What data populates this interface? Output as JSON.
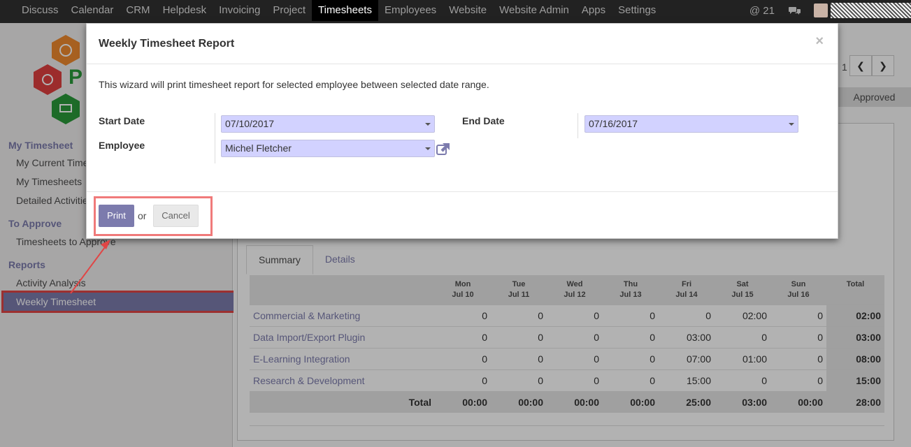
{
  "topbar": {
    "menu": [
      "Discuss",
      "Calendar",
      "CRM",
      "Helpdesk",
      "Invoicing",
      "Project",
      "Timesheets",
      "Employees",
      "Website",
      "Website Admin",
      "Apps",
      "Settings"
    ],
    "active_index": 6,
    "mention_count": "@ 21",
    "chat_icon": "chat-bubbles-icon"
  },
  "sidebar": {
    "sections": [
      {
        "title": "My Timesheet",
        "items": [
          "My Current Timesheet",
          "My Timesheets",
          "Detailed Activities"
        ]
      },
      {
        "title": "To Approve",
        "items": [
          "Timesheets to Approve"
        ]
      },
      {
        "title": "Reports",
        "items": [
          "Activity Analysis",
          "Weekly Timesheet"
        ]
      }
    ],
    "active_item": "Weekly Timesheet"
  },
  "content": {
    "pager": "1",
    "status": "Approved",
    "tabs": [
      "Summary",
      "Details"
    ],
    "active_tab": "Summary",
    "table": {
      "headers": [
        {
          "day": "Mon",
          "date": "Jul 10"
        },
        {
          "day": "Tue",
          "date": "Jul 11"
        },
        {
          "day": "Wed",
          "date": "Jul 12"
        },
        {
          "day": "Thu",
          "date": "Jul 13"
        },
        {
          "day": "Fri",
          "date": "Jul 14"
        },
        {
          "day": "Sat",
          "date": "Jul 15"
        },
        {
          "day": "Sun",
          "date": "Jul 16"
        }
      ],
      "total_header": "Total",
      "rows": [
        {
          "name": "Commercial & Marketing",
          "values": [
            "0",
            "0",
            "0",
            "0",
            "0",
            "02:00",
            "0"
          ],
          "total": "02:00"
        },
        {
          "name": "Data Import/Export Plugin",
          "values": [
            "0",
            "0",
            "0",
            "0",
            "03:00",
            "0",
            "0"
          ],
          "total": "03:00"
        },
        {
          "name": "E-Learning Integration",
          "values": [
            "0",
            "0",
            "0",
            "0",
            "07:00",
            "01:00",
            "0"
          ],
          "total": "08:00"
        },
        {
          "name": "Research & Development",
          "values": [
            "0",
            "0",
            "0",
            "0",
            "15:00",
            "0",
            "0"
          ],
          "total": "15:00"
        }
      ],
      "footer_label": "Total",
      "footer_values": [
        "00:00",
        "00:00",
        "00:00",
        "00:00",
        "25:00",
        "03:00",
        "00:00"
      ],
      "footer_total": "28:00"
    }
  },
  "modal": {
    "title": "Weekly Timesheet Report",
    "close": "×",
    "description": "This wizard will print timesheet report for selected employee between selected date range.",
    "start_date_label": "Start Date",
    "start_date_value": "07/10/2017",
    "end_date_label": "End Date",
    "end_date_value": "07/16/2017",
    "employee_label": "Employee",
    "employee_value": "Michel Fletcher",
    "print_label": "Print",
    "or_label": "or",
    "cancel_label": "Cancel"
  },
  "colors": {
    "accent": "#7c7bad",
    "highlight": "#e04646",
    "navbar": "#222222"
  }
}
